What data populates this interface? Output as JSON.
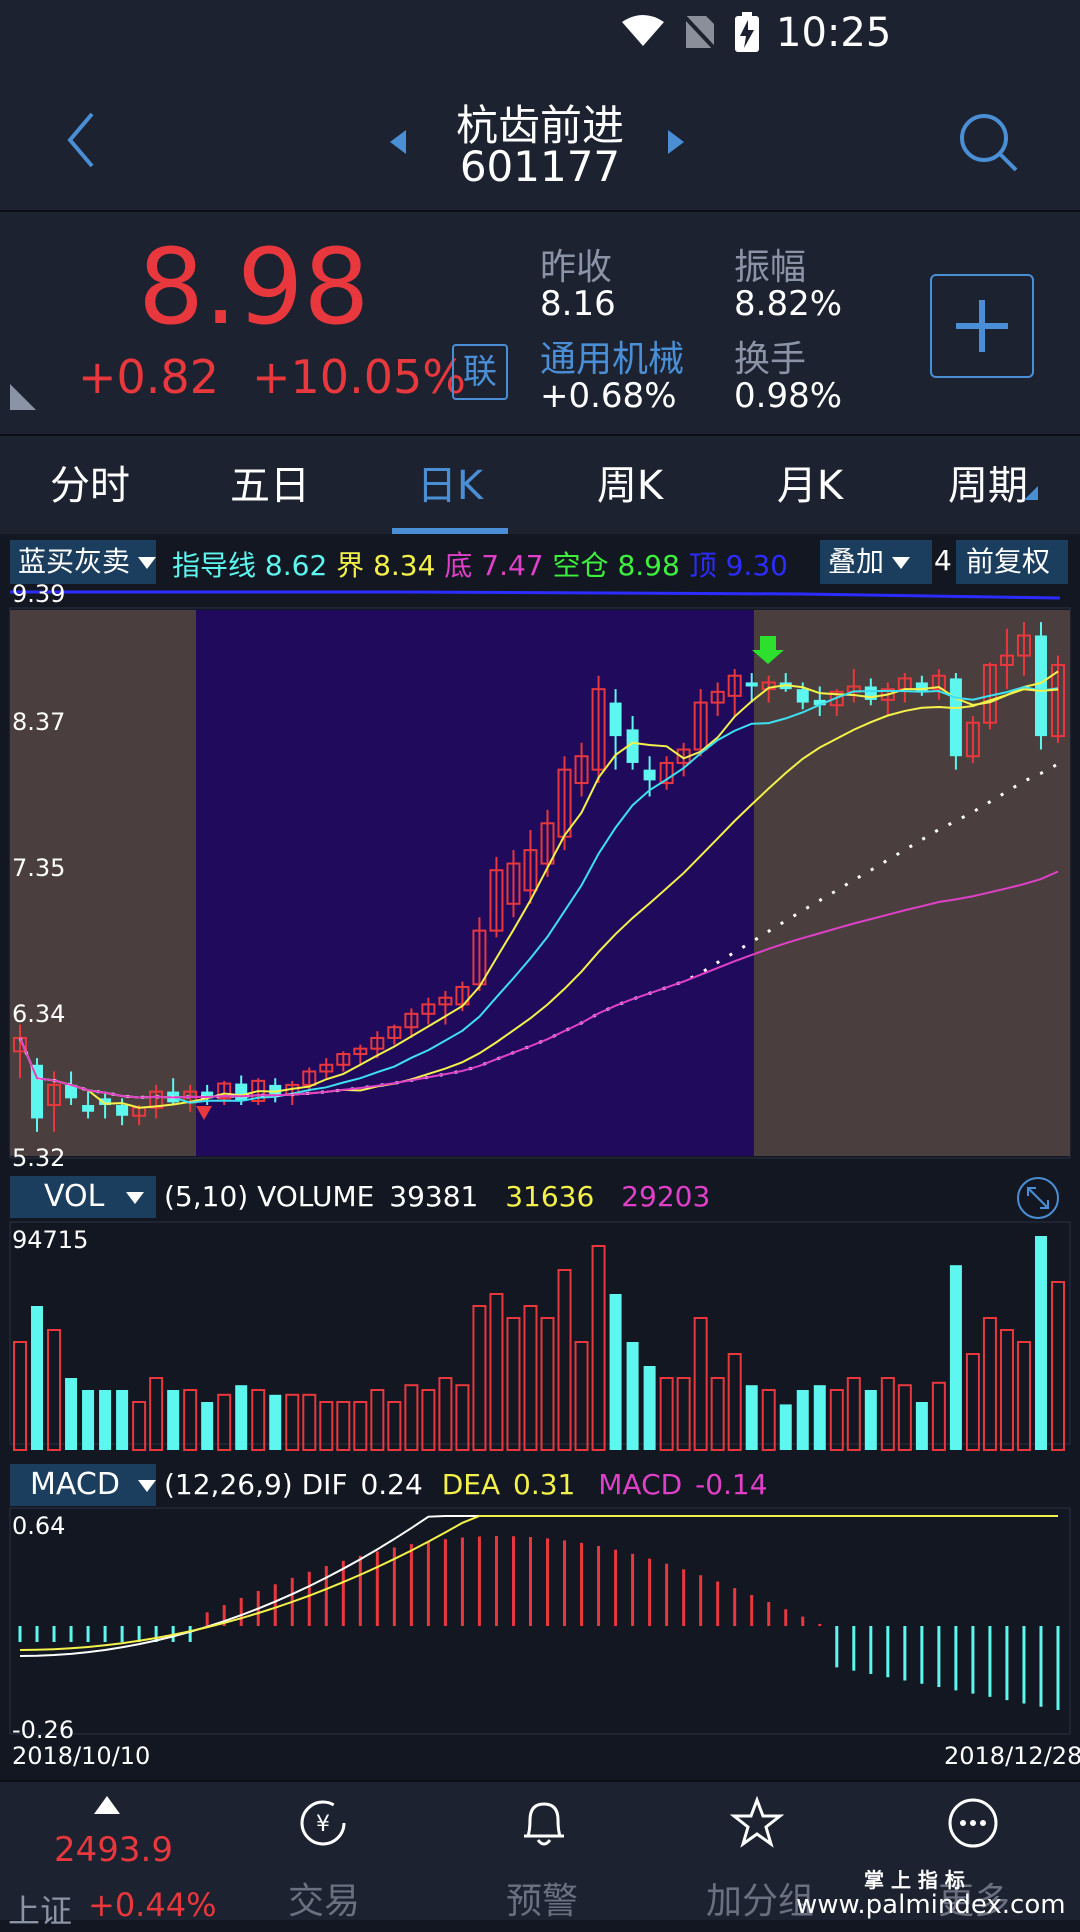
{
  "status": {
    "time": "10:25"
  },
  "header": {
    "stock_name": "杭齿前进",
    "stock_code": "601177"
  },
  "quote": {
    "price": "8.98",
    "change": "+0.82",
    "change_pct": "+10.05%",
    "link_badge": "联",
    "prev_close_label": "昨收",
    "prev_close": "8.16",
    "amplitude_label": "振幅",
    "amplitude": "8.82%",
    "sector_label": "通用机械",
    "sector_change": "+0.68%",
    "turnover_label": "换手",
    "turnover": "0.98%",
    "add_label": "+"
  },
  "tabs": [
    {
      "label": "分时"
    },
    {
      "label": "五日"
    },
    {
      "label": "日K"
    },
    {
      "label": "周K"
    },
    {
      "label": "月K"
    },
    {
      "label": "周期"
    }
  ],
  "indicator": {
    "name": "蓝买灰卖",
    "guide_label": "指导线",
    "guide": "8.62",
    "jie_label": "界",
    "jie": "8.34",
    "di_label": "底",
    "di": "7.47",
    "kong_label": "空仓",
    "kong": "8.98",
    "ding_label": "顶",
    "ding": "9.30",
    "overlay_label": "叠加",
    "overlay_count": "4",
    "adjust_label": "前复权"
  },
  "kline_axis": {
    "y_top": "9.39",
    "y2": "8.37",
    "y3": "7.35",
    "y4": "6.34",
    "y_bottom": "5.32"
  },
  "vol": {
    "name": "VOL",
    "params": "(5,10) VOLUME",
    "volume": "39381",
    "ma5": "31636",
    "ma10": "29203",
    "y_top": "94715"
  },
  "macd": {
    "name": "MACD",
    "params": "(12,26,9) DIF",
    "dif": "0.24",
    "dea_label": "DEA",
    "dea": "0.31",
    "macd_label": "MACD",
    "macd": "-0.14",
    "y_top": "0.64",
    "y_bottom": "-0.26"
  },
  "dates": {
    "start": "2018/10/10",
    "end": "2018/12/28"
  },
  "nav": {
    "index_value": "2493.9",
    "index_name": "上证",
    "index_change": "+0.44%",
    "items": [
      {
        "label": "交易"
      },
      {
        "label": "预警"
      },
      {
        "label": "加分组"
      },
      {
        "label": "更多"
      }
    ],
    "watermark_top": "掌 上 指 标",
    "watermark_url": "www.palmindex.com"
  },
  "colors": {
    "up": "#e8383d",
    "down": "#5ef7f0",
    "accent": "#4a8fd6",
    "ma_yellow": "#f4f24a",
    "ma_magenta": "#e040c8"
  },
  "chart_data": {
    "type": "candlestick",
    "ylim": [
      5.32,
      9.39
    ],
    "candles_ohlc_approx": [
      [
        6.1,
        6.3,
        5.9,
        6.2
      ],
      [
        6.0,
        6.05,
        5.5,
        5.6
      ],
      [
        5.7,
        5.95,
        5.5,
        5.85
      ],
      [
        5.85,
        5.95,
        5.7,
        5.75
      ],
      [
        5.7,
        5.8,
        5.6,
        5.65
      ],
      [
        5.75,
        5.8,
        5.6,
        5.7
      ],
      [
        5.7,
        5.75,
        5.55,
        5.62
      ],
      [
        5.62,
        5.7,
        5.55,
        5.68
      ],
      [
        5.68,
        5.85,
        5.6,
        5.8
      ],
      [
        5.8,
        5.9,
        5.7,
        5.72
      ],
      [
        5.72,
        5.85,
        5.65,
        5.8
      ],
      [
        5.8,
        5.85,
        5.7,
        5.75
      ],
      [
        5.75,
        5.88,
        5.7,
        5.86
      ],
      [
        5.86,
        5.92,
        5.7,
        5.73
      ],
      [
        5.73,
        5.9,
        5.7,
        5.88
      ],
      [
        5.85,
        5.9,
        5.72,
        5.78
      ],
      [
        5.78,
        5.88,
        5.7,
        5.85
      ],
      [
        5.85,
        5.98,
        5.8,
        5.95
      ],
      [
        5.95,
        6.05,
        5.9,
        6.0
      ],
      [
        6.0,
        6.1,
        5.95,
        6.08
      ],
      [
        6.08,
        6.15,
        6.0,
        6.12
      ],
      [
        6.12,
        6.25,
        6.05,
        6.2
      ],
      [
        6.2,
        6.3,
        6.15,
        6.28
      ],
      [
        6.28,
        6.42,
        6.2,
        6.38
      ],
      [
        6.38,
        6.5,
        6.3,
        6.45
      ],
      [
        6.45,
        6.55,
        6.3,
        6.5
      ],
      [
        6.45,
        6.62,
        6.4,
        6.58
      ],
      [
        6.6,
        7.1,
        6.55,
        7.0
      ],
      [
        7.0,
        7.55,
        6.95,
        7.45
      ],
      [
        7.2,
        7.6,
        7.1,
        7.5
      ],
      [
        7.3,
        7.75,
        7.2,
        7.6
      ],
      [
        7.5,
        7.9,
        7.4,
        7.8
      ],
      [
        7.7,
        8.3,
        7.6,
        8.2
      ],
      [
        8.1,
        8.4,
        8.0,
        8.3
      ],
      [
        8.2,
        8.9,
        8.1,
        8.8
      ],
      [
        8.7,
        8.8,
        8.2,
        8.45
      ],
      [
        8.5,
        8.6,
        8.2,
        8.25
      ],
      [
        8.2,
        8.3,
        8.0,
        8.12
      ],
      [
        8.1,
        8.3,
        8.05,
        8.25
      ],
      [
        8.25,
        8.4,
        8.15,
        8.35
      ],
      [
        8.35,
        8.8,
        8.3,
        8.7
      ],
      [
        8.7,
        8.85,
        8.6,
        8.78
      ],
      [
        8.75,
        8.95,
        8.6,
        8.9
      ],
      [
        8.85,
        8.92,
        8.7,
        8.82
      ],
      [
        8.8,
        8.9,
        8.7,
        8.85
      ],
      [
        8.85,
        8.92,
        8.78,
        8.8
      ],
      [
        8.8,
        8.85,
        8.65,
        8.7
      ],
      [
        8.72,
        8.82,
        8.6,
        8.68
      ],
      [
        8.68,
        8.8,
        8.6,
        8.78
      ],
      [
        8.78,
        8.95,
        8.7,
        8.82
      ],
      [
        8.82,
        8.88,
        8.68,
        8.72
      ],
      [
        8.72,
        8.85,
        8.6,
        8.8
      ],
      [
        8.8,
        8.92,
        8.7,
        8.88
      ],
      [
        8.85,
        8.9,
        8.75,
        8.78
      ],
      [
        8.8,
        8.95,
        8.72,
        8.9
      ],
      [
        8.88,
        8.92,
        8.2,
        8.3
      ],
      [
        8.3,
        8.6,
        8.25,
        8.55
      ],
      [
        8.55,
        9.0,
        8.5,
        8.98
      ],
      [
        8.98,
        9.25,
        8.8,
        9.05
      ],
      [
        9.05,
        9.3,
        8.9,
        9.2
      ],
      [
        9.2,
        9.3,
        8.35,
        8.45
      ],
      [
        8.45,
        9.05,
        8.4,
        8.98
      ]
    ]
  }
}
